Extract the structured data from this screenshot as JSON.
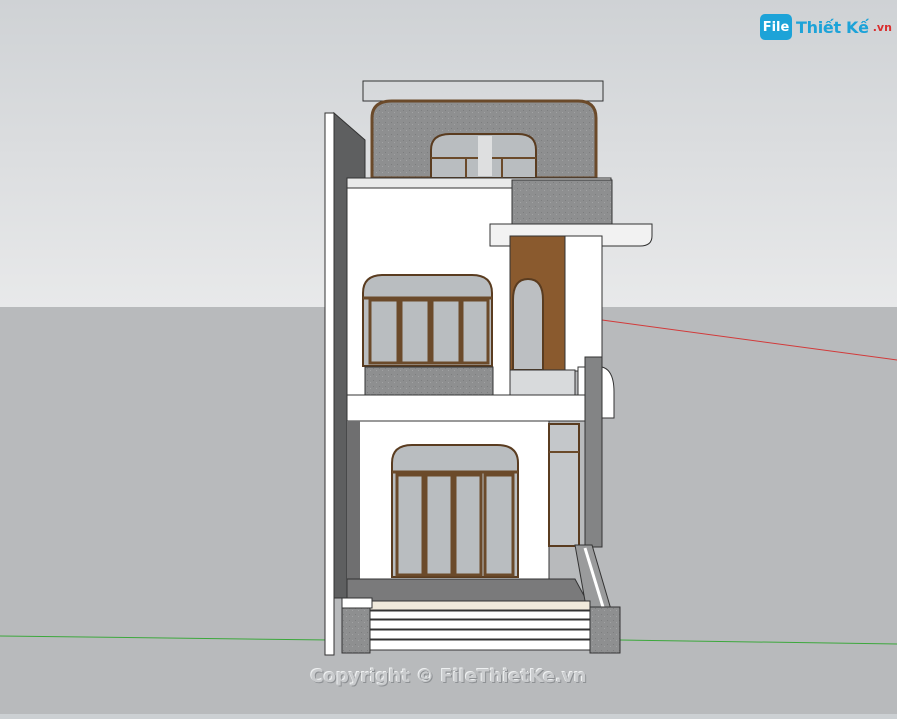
{
  "scene": {
    "sky_color_top": "#d0d3d6",
    "sky_color_bottom": "#e7e8e9",
    "ground_color": "#b9bbbd",
    "axis_red": "#d23a3a",
    "axis_green": "#3ca83c"
  },
  "watermark": {
    "logo_badge": "File",
    "logo_text": "Thiết Kế",
    "logo_suffix": ".vn",
    "logo_color": "#1da3d8",
    "copyright": "Copyright © FileThietKe.vn"
  },
  "building": {
    "wall_color": "#ffffff",
    "concrete_color": "#8f9091",
    "wood_color": "#8a5a2e",
    "glass_color": "#b8bcbf"
  }
}
